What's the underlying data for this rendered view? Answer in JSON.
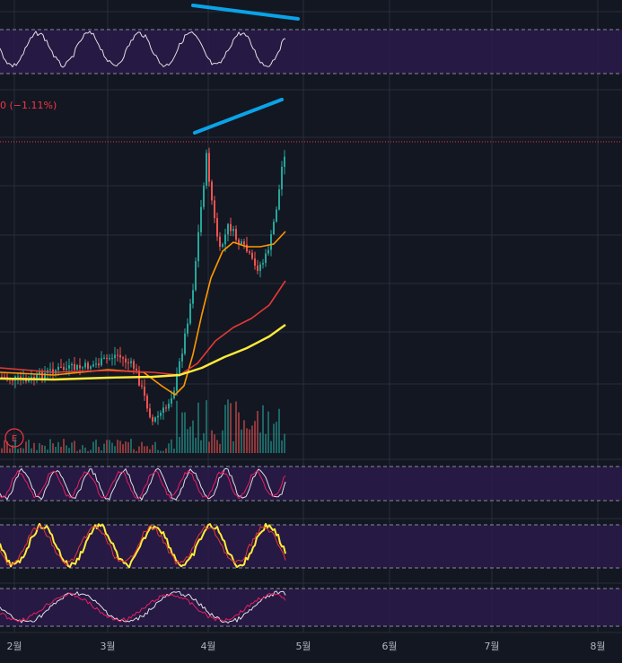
{
  "chart_data": {
    "type": "candlestick",
    "x_axis_ticks": [
      "2월",
      "3월",
      "4월",
      "5월",
      "6월",
      "7월",
      "8월"
    ],
    "change_label": "0 (−1.11%)",
    "earnings_marker": "E",
    "colors": {
      "background": "#131722",
      "grid": "#2a2e39",
      "up": "#26a69a",
      "down": "#ef5350",
      "band_fill": "#2a1a4a",
      "ma_fast": "#ff9800",
      "ma_mid": "#e53935",
      "ma_slow": "#ffeb3b",
      "divergence": "#0aa3e8",
      "price_line": "#f23645"
    },
    "price_series_note": "",
    "ma_fast": [],
    "ma_mid": [],
    "ma_slow": []
  }
}
